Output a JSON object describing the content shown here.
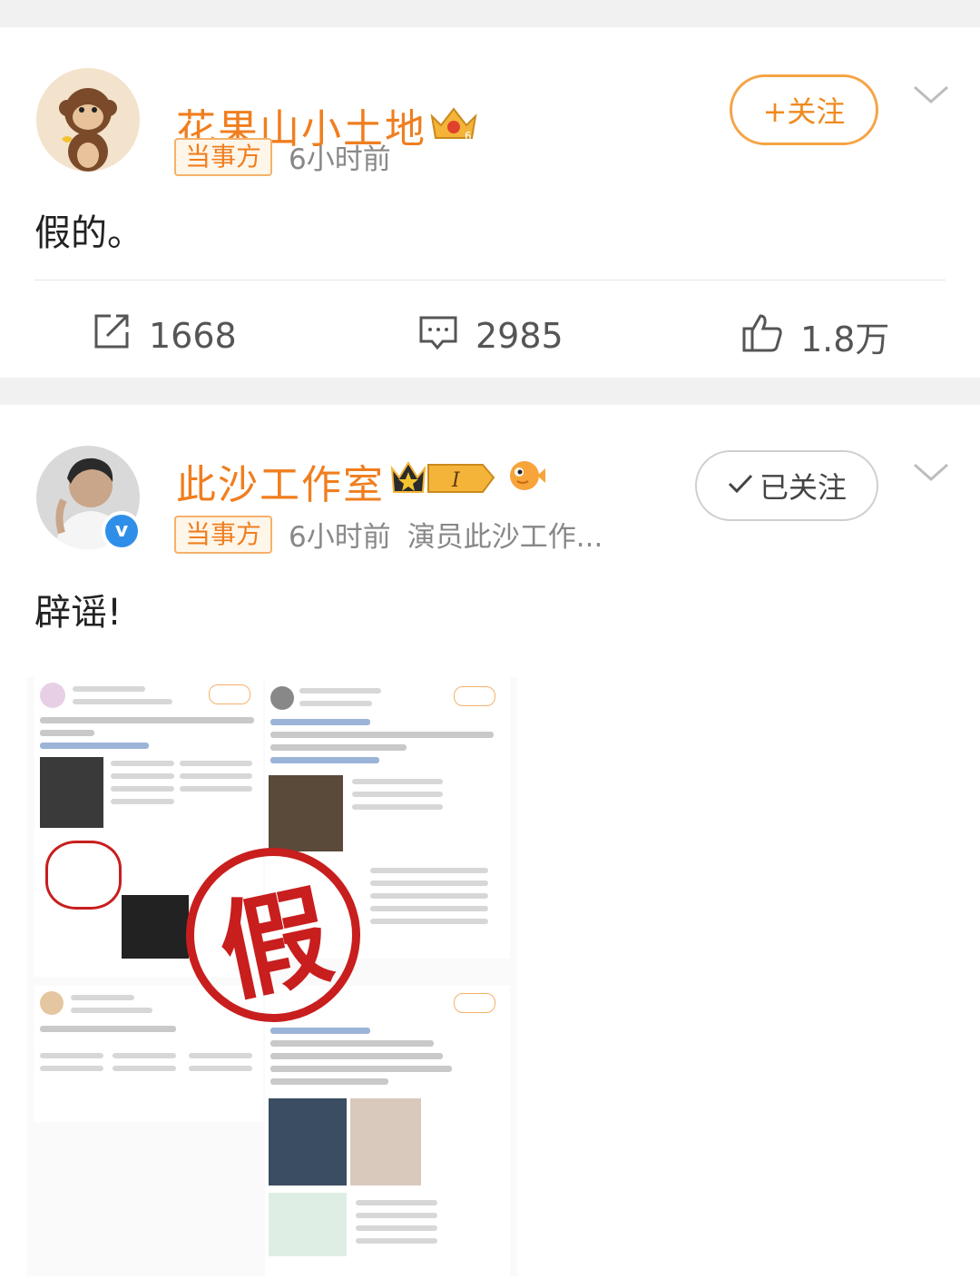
{
  "posts": [
    {
      "username": "花果山小土地",
      "tag": "当事方",
      "time": "6小时前",
      "follow_label": "+关注",
      "text": "假的。",
      "actions": {
        "reposts": "1668",
        "comments": "2985",
        "likes": "1.8万"
      }
    },
    {
      "username": "此沙工作室",
      "tag": "当事方",
      "time": "6小时前",
      "source": "演员此沙工作...",
      "follow_label": "已关注",
      "text": "辟谣!",
      "image_stamp": "假"
    }
  ],
  "colors": {
    "username": "#f07e1e",
    "follow_border": "#f5a445",
    "stamp": "#c81e1e",
    "verified": "#2f8fe8"
  }
}
